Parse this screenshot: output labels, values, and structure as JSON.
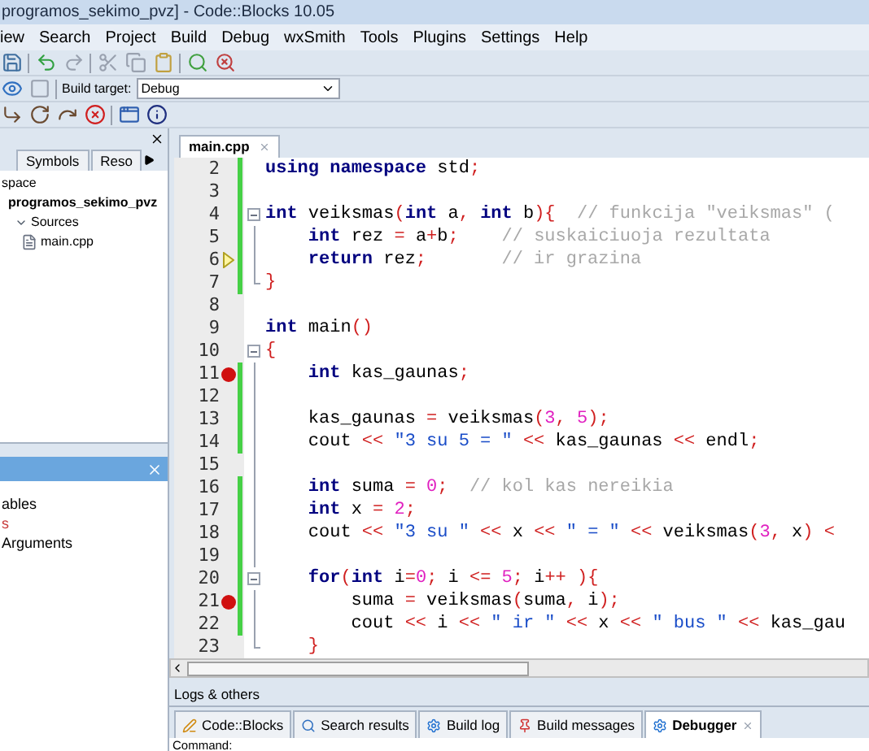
{
  "window": {
    "title": "programos_sekimo_pvz] - Code::Blocks 10.05"
  },
  "menu": [
    "iew",
    "Search",
    "Project",
    "Build",
    "Debug",
    "wxSmith",
    "Tools",
    "Plugins",
    "Settings",
    "Help"
  ],
  "build_target": {
    "label": "Build target:",
    "value": "Debug"
  },
  "management": {
    "tabs": [
      {
        "label": "Symbols",
        "selected": false
      },
      {
        "label": "Reso",
        "selected": false
      }
    ],
    "tree": [
      {
        "label": "space",
        "bold": false,
        "children": [
          {
            "label": "programos_sekimo_pvz",
            "bold": true,
            "children": [
              {
                "label": "Sources",
                "bold": false,
                "expanded": true,
                "children": [
                  {
                    "label": "main.cpp",
                    "bold": false,
                    "kind": "file"
                  }
                ]
              }
            ]
          }
        ]
      }
    ]
  },
  "watches": {
    "items": [
      {
        "label": "ables",
        "color": "#000000"
      },
      {
        "label": "s",
        "color": "#c83c3c"
      },
      {
        "label": "Arguments",
        "color": "#000000"
      }
    ]
  },
  "editor": {
    "tabs": [
      {
        "label": "main.cpp",
        "selected": true
      }
    ],
    "lines": [
      {
        "number": "2",
        "changed": true,
        "breakpoint": false,
        "current": false,
        "fold_toggle": false,
        "fold_guide": false,
        "fold_end": false,
        "tokens": [
          {
            "kind": "kw",
            "text": "using"
          },
          {
            "kind": "kw",
            "text": " namespace"
          },
          {
            "kind": "id",
            "text": " std"
          },
          {
            "kind": "op",
            "text": ";"
          }
        ]
      },
      {
        "number": "3",
        "changed": true,
        "breakpoint": false,
        "current": false,
        "fold_toggle": false,
        "fold_guide": false,
        "fold_end": false
      },
      {
        "number": "4",
        "changed": true,
        "breakpoint": false,
        "current": false,
        "fold_toggle": true,
        "fold_guide": false,
        "fold_end": false,
        "tokens": [
          {
            "kind": "kw",
            "text": "int"
          },
          {
            "kind": "id",
            "text": " veiksmas"
          },
          {
            "kind": "op",
            "text": "("
          },
          {
            "kind": "kw",
            "text": "int"
          },
          {
            "kind": "id",
            "text": " a"
          },
          {
            "kind": "op",
            "text": ","
          },
          {
            "kind": "kw",
            "text": " int"
          },
          {
            "kind": "id",
            "text": " b"
          },
          {
            "kind": "op",
            "text": "){"
          },
          {
            "kind": "cm",
            "text": "  // funkcija \"veiksmas\" ("
          }
        ]
      },
      {
        "number": "5",
        "changed": true,
        "breakpoint": false,
        "current": false,
        "fold_toggle": false,
        "fold_guide": true,
        "fold_end": false,
        "tokens": [
          {
            "kind": "kw",
            "text": "    int"
          },
          {
            "kind": "id",
            "text": " rez "
          },
          {
            "kind": "op",
            "text": "="
          },
          {
            "kind": "id",
            "text": " a"
          },
          {
            "kind": "op",
            "text": "+"
          },
          {
            "kind": "id",
            "text": "b"
          },
          {
            "kind": "op",
            "text": ";"
          },
          {
            "kind": "cm",
            "text": "    // suskaiciuoja rezultata"
          }
        ]
      },
      {
        "number": "6",
        "changed": true,
        "breakpoint": false,
        "current": true,
        "fold_toggle": false,
        "fold_guide": true,
        "fold_end": false,
        "tokens": [
          {
            "kind": "kw",
            "text": "    return"
          },
          {
            "kind": "id",
            "text": " rez"
          },
          {
            "kind": "op",
            "text": ";"
          },
          {
            "kind": "cm",
            "text": "       // ir grazina"
          }
        ]
      },
      {
        "number": "7",
        "changed": true,
        "breakpoint": false,
        "current": false,
        "fold_toggle": false,
        "fold_guide": false,
        "fold_end": true,
        "tokens": [
          {
            "kind": "op",
            "text": "}"
          }
        ]
      },
      {
        "number": "8",
        "changed": false,
        "breakpoint": false,
        "current": false,
        "fold_toggle": false,
        "fold_guide": false,
        "fold_end": false
      },
      {
        "number": "9",
        "changed": false,
        "breakpoint": false,
        "current": false,
        "fold_toggle": false,
        "fold_guide": false,
        "fold_end": false,
        "tokens": [
          {
            "kind": "kw",
            "text": "int"
          },
          {
            "kind": "id",
            "text": " main"
          },
          {
            "kind": "op",
            "text": "()"
          }
        ]
      },
      {
        "number": "10",
        "changed": false,
        "breakpoint": false,
        "current": false,
        "fold_toggle": true,
        "fold_guide": false,
        "fold_end": false,
        "tokens": [
          {
            "kind": "op",
            "text": "{"
          }
        ]
      },
      {
        "number": "11",
        "changed": true,
        "breakpoint": true,
        "current": false,
        "fold_toggle": false,
        "fold_guide": true,
        "fold_end": false,
        "tokens": [
          {
            "kind": "kw",
            "text": "    int"
          },
          {
            "kind": "id",
            "text": " kas_gaunas"
          },
          {
            "kind": "op",
            "text": ";"
          }
        ]
      },
      {
        "number": "12",
        "changed": true,
        "breakpoint": false,
        "current": false,
        "fold_toggle": false,
        "fold_guide": true,
        "fold_end": false
      },
      {
        "number": "13",
        "changed": true,
        "breakpoint": false,
        "current": false,
        "fold_toggle": false,
        "fold_guide": true,
        "fold_end": false,
        "tokens": [
          {
            "kind": "id",
            "text": "    kas_gaunas "
          },
          {
            "kind": "op",
            "text": "="
          },
          {
            "kind": "id",
            "text": " veiksmas"
          },
          {
            "kind": "op",
            "text": "("
          },
          {
            "kind": "num",
            "text": "3"
          },
          {
            "kind": "op",
            "text": ","
          },
          {
            "kind": "num",
            "text": " 5"
          },
          {
            "kind": "op",
            "text": ");"
          }
        ]
      },
      {
        "number": "14",
        "changed": true,
        "breakpoint": false,
        "current": false,
        "fold_toggle": false,
        "fold_guide": true,
        "fold_end": false,
        "tokens": [
          {
            "kind": "id",
            "text": "    cout "
          },
          {
            "kind": "op",
            "text": "<<"
          },
          {
            "kind": "str",
            "text": " \"3 su 5 = \""
          },
          {
            "kind": "op",
            "text": " <<"
          },
          {
            "kind": "id",
            "text": " kas_gaunas "
          },
          {
            "kind": "op",
            "text": "<<"
          },
          {
            "kind": "id",
            "text": " endl"
          },
          {
            "kind": "op",
            "text": ";"
          }
        ]
      },
      {
        "number": "15",
        "changed": false,
        "breakpoint": false,
        "current": false,
        "fold_toggle": false,
        "fold_guide": true,
        "fold_end": false
      },
      {
        "number": "16",
        "changed": true,
        "breakpoint": false,
        "current": false,
        "fold_toggle": false,
        "fold_guide": true,
        "fold_end": false,
        "tokens": [
          {
            "kind": "kw",
            "text": "    int"
          },
          {
            "kind": "id",
            "text": " suma "
          },
          {
            "kind": "op",
            "text": "="
          },
          {
            "kind": "num",
            "text": " 0"
          },
          {
            "kind": "op",
            "text": ";"
          },
          {
            "kind": "cm",
            "text": "  // kol kas nereikia"
          }
        ]
      },
      {
        "number": "17",
        "changed": true,
        "breakpoint": false,
        "current": false,
        "fold_toggle": false,
        "fold_guide": true,
        "fold_end": false,
        "tokens": [
          {
            "kind": "kw",
            "text": "    int"
          },
          {
            "kind": "id",
            "text": " x "
          },
          {
            "kind": "op",
            "text": "="
          },
          {
            "kind": "num",
            "text": " 2"
          },
          {
            "kind": "op",
            "text": ";"
          }
        ]
      },
      {
        "number": "18",
        "changed": true,
        "breakpoint": false,
        "current": false,
        "fold_toggle": false,
        "fold_guide": true,
        "fold_end": false,
        "tokens": [
          {
            "kind": "id",
            "text": "    cout "
          },
          {
            "kind": "op",
            "text": "<<"
          },
          {
            "kind": "str",
            "text": " \"3 su \""
          },
          {
            "kind": "op",
            "text": " <<"
          },
          {
            "kind": "id",
            "text": " x "
          },
          {
            "kind": "op",
            "text": "<<"
          },
          {
            "kind": "str",
            "text": " \" = \""
          },
          {
            "kind": "op",
            "text": " <<"
          },
          {
            "kind": "id",
            "text": " veiksmas"
          },
          {
            "kind": "op",
            "text": "("
          },
          {
            "kind": "num",
            "text": "3"
          },
          {
            "kind": "op",
            "text": ","
          },
          {
            "kind": "id",
            "text": " x"
          },
          {
            "kind": "op",
            "text": ") <"
          }
        ]
      },
      {
        "number": "19",
        "changed": true,
        "breakpoint": false,
        "current": false,
        "fold_toggle": false,
        "fold_guide": true,
        "fold_end": false
      },
      {
        "number": "20",
        "changed": true,
        "breakpoint": false,
        "current": false,
        "fold_toggle": true,
        "fold_guide": false,
        "fold_end": false,
        "tokens": [
          {
            "kind": "kw",
            "text": "    for"
          },
          {
            "kind": "op",
            "text": "("
          },
          {
            "kind": "kw",
            "text": "int"
          },
          {
            "kind": "id",
            "text": " i"
          },
          {
            "kind": "op",
            "text": "="
          },
          {
            "kind": "num",
            "text": "0"
          },
          {
            "kind": "op",
            "text": ";"
          },
          {
            "kind": "id",
            "text": " i "
          },
          {
            "kind": "op",
            "text": "<="
          },
          {
            "kind": "num",
            "text": " 5"
          },
          {
            "kind": "op",
            "text": ";"
          },
          {
            "kind": "id",
            "text": " i"
          },
          {
            "kind": "op",
            "text": "++ ){"
          }
        ]
      },
      {
        "number": "21",
        "changed": true,
        "breakpoint": true,
        "current": false,
        "fold_toggle": false,
        "fold_guide": true,
        "fold_end": false,
        "tokens": [
          {
            "kind": "id",
            "text": "        suma "
          },
          {
            "kind": "op",
            "text": "="
          },
          {
            "kind": "id",
            "text": " veiksmas"
          },
          {
            "kind": "op",
            "text": "("
          },
          {
            "kind": "id",
            "text": "suma"
          },
          {
            "kind": "op",
            "text": ","
          },
          {
            "kind": "id",
            "text": " i"
          },
          {
            "kind": "op",
            "text": ");"
          }
        ]
      },
      {
        "number": "22",
        "changed": true,
        "breakpoint": false,
        "current": false,
        "fold_toggle": false,
        "fold_guide": true,
        "fold_end": false,
        "tokens": [
          {
            "kind": "id",
            "text": "        cout "
          },
          {
            "kind": "op",
            "text": "<<"
          },
          {
            "kind": "id",
            "text": " i "
          },
          {
            "kind": "op",
            "text": "<<"
          },
          {
            "kind": "str",
            "text": " \" ir \""
          },
          {
            "kind": "op",
            "text": " <<"
          },
          {
            "kind": "id",
            "text": " x "
          },
          {
            "kind": "op",
            "text": "<<"
          },
          {
            "kind": "str",
            "text": " \" bus \""
          },
          {
            "kind": "op",
            "text": " <<"
          },
          {
            "kind": "id",
            "text": " kas_gau"
          }
        ]
      },
      {
        "number": "23",
        "changed": false,
        "breakpoint": false,
        "current": false,
        "fold_toggle": false,
        "fold_guide": false,
        "fold_end": true,
        "tokens": [
          {
            "kind": "op",
            "text": "    }"
          }
        ]
      }
    ]
  },
  "logs": {
    "title": "Logs & others",
    "tabs": [
      {
        "label": "Code::Blocks",
        "kind": "pencil",
        "selected": false
      },
      {
        "label": "Search results",
        "kind": "search",
        "selected": false
      },
      {
        "label": "Build log",
        "kind": "gear",
        "selected": false
      },
      {
        "label": "Build messages",
        "kind": "pin",
        "selected": false
      },
      {
        "label": "Debugger",
        "kind": "gear",
        "selected": true
      }
    ],
    "command_label": "Command:"
  }
}
